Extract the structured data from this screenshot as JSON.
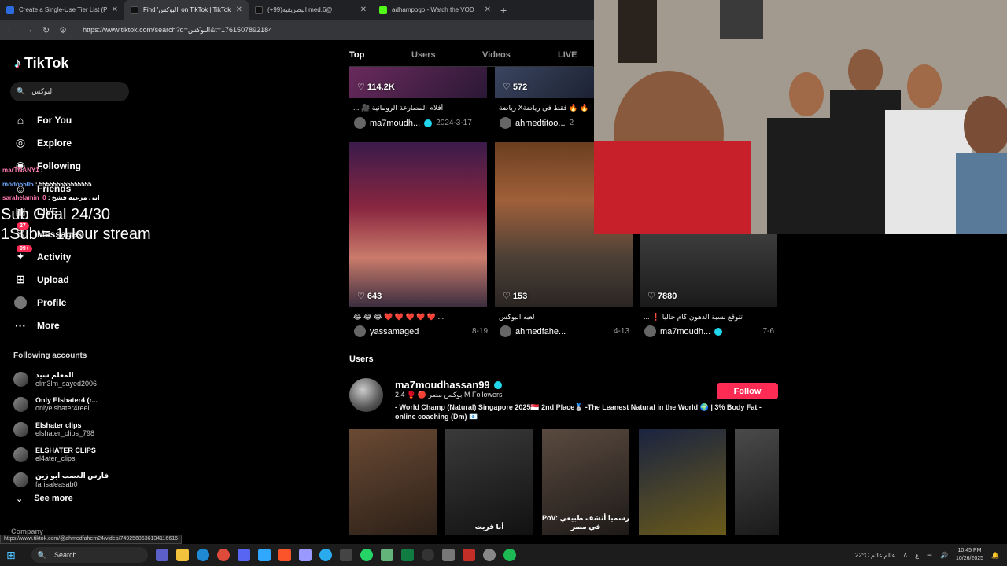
{
  "browser": {
    "tabs": [
      {
        "title": "Create a Single-Use Tier List (P",
        "color": "#2d6cdf",
        "active": false
      },
      {
        "title": "Find 'البوكس' on TikTok | TikTok",
        "color": "#111111",
        "active": true
      },
      {
        "title": "(+99)البطريقية med.6@",
        "color": "#111111",
        "active": false
      },
      {
        "title": "adhampogo - Watch the VOD",
        "color": "#53fc18",
        "active": false
      }
    ],
    "url": "https://www.tiktok.com/search?q=البوكس&t=1761507892184"
  },
  "tiktok": {
    "logo": "TikTok",
    "search_value": "البوكس",
    "nav": [
      {
        "label": "For You",
        "icon": "home-icon",
        "badge": ""
      },
      {
        "label": "Explore",
        "icon": "compass-icon",
        "badge": ""
      },
      {
        "label": "Following",
        "icon": "following-icon",
        "badge": ""
      },
      {
        "label": "Friends",
        "icon": "friends-icon",
        "badge": ""
      },
      {
        "label": "LIVE",
        "icon": "live-icon",
        "badge": ""
      },
      {
        "label": "Messages",
        "icon": "messages-icon",
        "badge": "27"
      },
      {
        "label": "Activity",
        "icon": "activity-icon",
        "badge": "99+"
      },
      {
        "label": "Upload",
        "icon": "upload-icon",
        "badge": ""
      },
      {
        "label": "Profile",
        "icon": "profile-icon",
        "badge": ""
      },
      {
        "label": "More",
        "icon": "more-icon",
        "badge": ""
      }
    ],
    "following_title": "Following accounts",
    "accounts": [
      {
        "name": "المعلم سيد",
        "user": "elm3lm_sayed2006"
      },
      {
        "name": "Only Elshater4 (r...",
        "user": "onlyelshater4reel"
      },
      {
        "name": "Elshater clips",
        "user": "elshater_clips_798"
      },
      {
        "name": "ELSHATER CLIPS",
        "user": "el4ater_clips"
      },
      {
        "name": "فارس العصب ابو زين",
        "user": "farisaleasab0"
      }
    ],
    "see_more": "See more",
    "company": "Company",
    "search_tabs": [
      "Top",
      "Users",
      "Videos",
      "LIVE"
    ],
    "videos_row1": [
      {
        "likes": "114.2K",
        "caption": "... 🎥 أفلام المصارعة الرومانية",
        "author": "ma7moudh...",
        "date": "2024-3-17"
      },
      {
        "likes": "572",
        "caption": "رياضة Xفقط في رياضة 🔥 🔥",
        "author": "ahmedtitoo...",
        "date": "2"
      }
    ],
    "videos_row2": [
      {
        "likes": "643",
        "caption": "😂 😂 😂 ❤️ ❤️ ❤️ ❤️ ❤️ ...",
        "author": "yassamaged",
        "date": "8-19"
      },
      {
        "likes": "153",
        "caption": "لعبه البوكس",
        "author": "ahmedfahe...",
        "date": "4-13"
      },
      {
        "likes": "7880",
        "caption": "... ❗ تتوقع نسبة الدهون كام حاليا",
        "author": "ma7moudh...",
        "date": "7-6"
      }
    ],
    "users_heading": "Users",
    "user": {
      "name": "ma7moudhassan99",
      "stats": "2.4 🥊 🔴 بوكس مصر M Followers",
      "bio": "- World Champ (Natural) Singapore 2025🇸🇬 2nd Place🥈 -The Leanest Natural in the World 🌍 | 3% Body Fat -online coaching (Dm) 📧",
      "follow_label": "Follow",
      "thumb_captions": [
        "",
        "أنا قريت",
        "PoV: رسميا أنشف طبيعي في مصر",
        "",
        ""
      ]
    }
  },
  "overlay": {
    "chat": [
      {
        "user": "marTNANY1",
        "text": ":",
        "color": "#ff7ab0"
      },
      {
        "user": "modo5505",
        "text": ": 555555555555555",
        "color": "#6fa8ff"
      },
      {
        "user": "sarahelamin_0",
        "text": ": اتى مرعية قشخ",
        "color": "#ff7ab0"
      }
    ],
    "subgoal": "Sub Goal 24/30",
    "substream": "1Sub = 1Hour stream"
  },
  "statusbar": "https://www.tiktok.com/@ahmedfahem24/video/7492568636134116616",
  "taskbar": {
    "search": "Search",
    "weather_temp": "22°C",
    "weather_desc": "عالم غائم",
    "lang": "ع",
    "time": "10:45 PM",
    "date": "10/26/2025"
  }
}
